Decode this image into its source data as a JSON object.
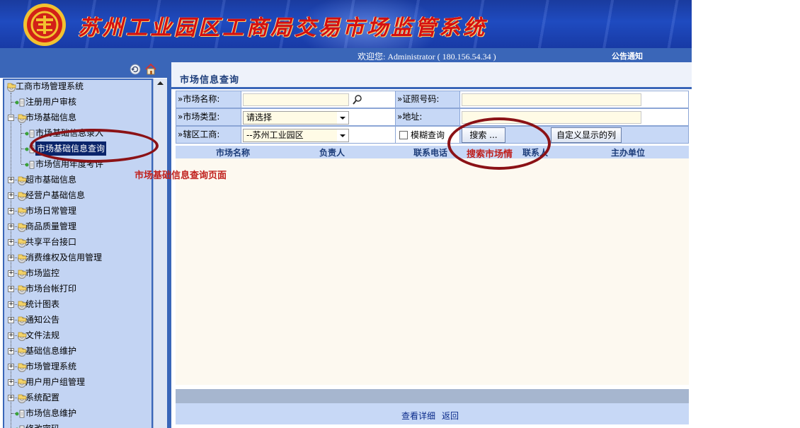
{
  "banner": {
    "title": "苏州工业园区工商局交易市场监管系统"
  },
  "welcome": {
    "text": "欢迎您: Administrator ( 180.156.54.34 )",
    "notice_link": "公告通知"
  },
  "sidebar": {
    "root": "工商市场管理系统",
    "items": [
      {
        "label": "注册用户审核"
      },
      {
        "label": "市场基础信息"
      },
      {
        "label": "市场基础信息录入"
      },
      {
        "label": "市场基础信息查询"
      },
      {
        "label": "市场信用年度考评"
      },
      {
        "label": "超市基础信息"
      },
      {
        "label": "经营户基础信息"
      },
      {
        "label": "市场日常管理"
      },
      {
        "label": "商品质量管理"
      },
      {
        "label": "共享平台接口"
      },
      {
        "label": "消费维权及信用管理"
      },
      {
        "label": "市场监控"
      },
      {
        "label": "市场台帐打印"
      },
      {
        "label": "统计图表"
      },
      {
        "label": "通知公告"
      },
      {
        "label": "文件法规"
      },
      {
        "label": "基础信息维护"
      },
      {
        "label": "市场管理系统"
      },
      {
        "label": "用户用户组管理"
      },
      {
        "label": "系统配置"
      },
      {
        "label": "市场信息维护"
      },
      {
        "label": "修改密码"
      }
    ]
  },
  "main": {
    "title": "市场信息查询",
    "form": {
      "market_name_label": "»市场名称:",
      "license_label": "»证照号码:",
      "market_type_label": "»市场类型:",
      "market_type_value": "请选择",
      "address_label": "»地址:",
      "district_label": "»辖区工商:",
      "district_value": "--苏州工业园区",
      "fuzzy_label": "模糊查询",
      "search_button": "搜索 ...",
      "custom_columns_button": "自定义显示的列"
    },
    "table": {
      "columns": [
        "市场名称",
        "负责人",
        "联系电话",
        "联系人",
        "主办单位"
      ]
    },
    "actions": {
      "view_detail": "查看详细",
      "back": "返回"
    }
  },
  "annotations": {
    "query_page": "市场基础信息查询页面",
    "search_market": "搜索市场情"
  },
  "colors": {
    "brand_blue": "#3a66b8",
    "annotation_red": "#c0201c"
  }
}
